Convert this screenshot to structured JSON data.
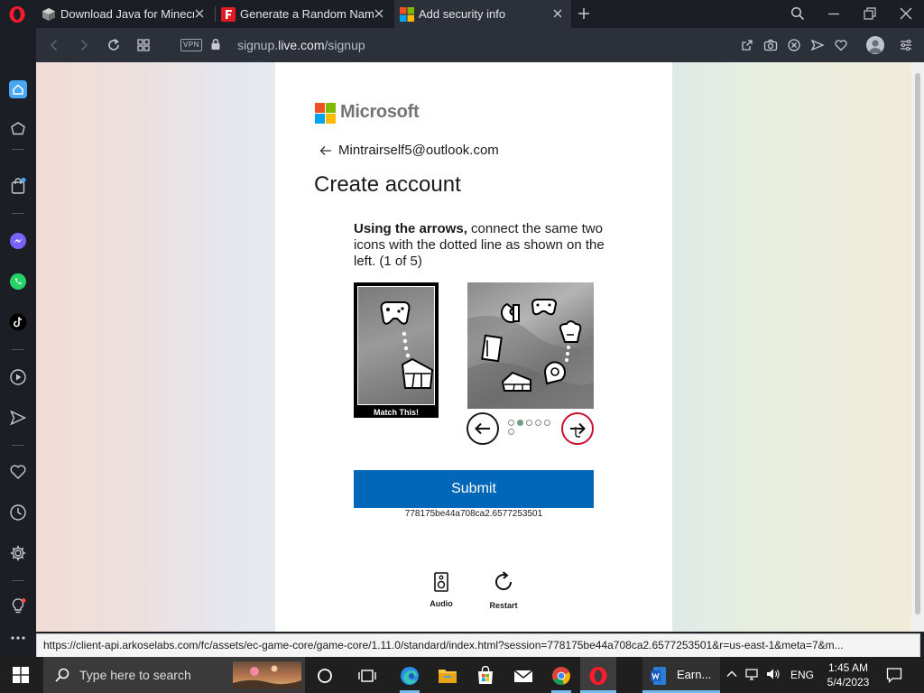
{
  "browser": {
    "tabs": [
      {
        "title": "Download Java for Minecra",
        "active": false
      },
      {
        "title": "Generate a Random Name",
        "active": false
      },
      {
        "title": "Add security info",
        "active": true
      }
    ],
    "vpn_label": "VPN",
    "url_prefix": "signup.",
    "url_domain": "live.com",
    "url_path": "/signup"
  },
  "page": {
    "brand": "Microsoft",
    "email": "Mintrairself5@outlook.com",
    "heading": "Create account",
    "captcha": {
      "instruction_bold": "Using the arrows,",
      "instruction_rest": " connect the same two icons with the dotted line as shown on the left. (1 of 5)",
      "reference_caption": "Match This!",
      "progress_total": 6,
      "progress_current": 2,
      "submit_label": "Submit",
      "session_id": "778175be44a708ca2.6577253501",
      "audio_label": "Audio",
      "restart_label": "Restart"
    }
  },
  "status_url": "https://client-api.arkoselabs.com/fc/assets/ec-game-core/game-core/1.11.0/standard/index.html?session=778175be44a708ca2.6577253501&r=us-east-1&meta=7&m...",
  "taskbar": {
    "search_placeholder": "Type here to search",
    "word_task_label": "Earn...",
    "language": "ENG",
    "time": "1:45 AM",
    "date": "5/4/2023"
  },
  "colors": {
    "ms_red": "#f25022",
    "ms_green": "#7fba00",
    "ms_blue": "#00a4ef",
    "ms_yellow": "#ffb900",
    "submit_blue": "#0067b8",
    "active_arrow_border": "#c8102e"
  }
}
